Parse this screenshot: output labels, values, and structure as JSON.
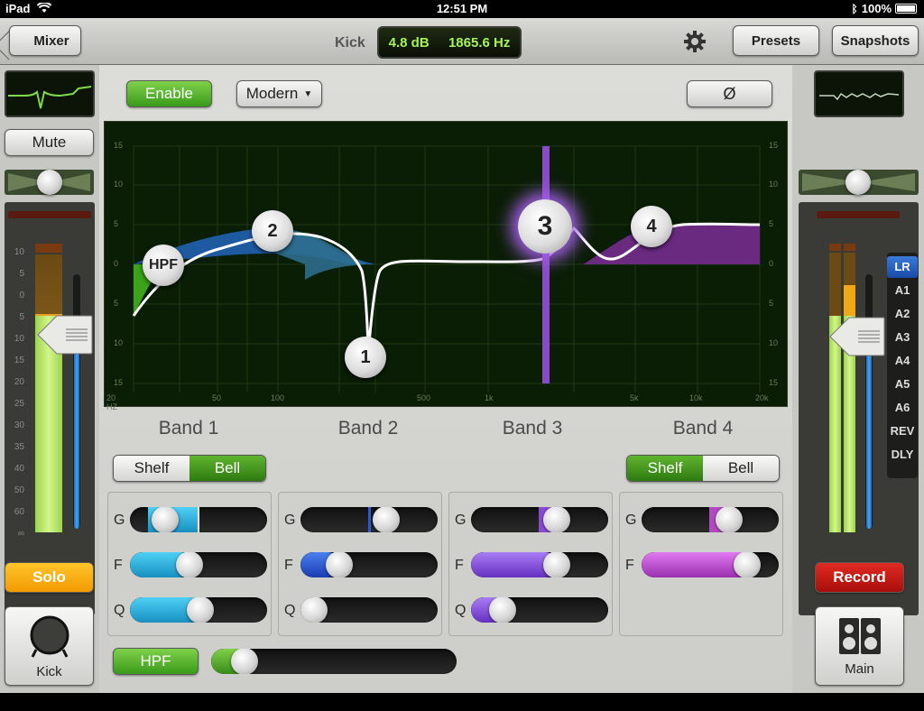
{
  "status": {
    "device": "iPad",
    "time": "12:51 PM",
    "battery": "100%"
  },
  "topbar": {
    "back_label": "Mixer",
    "channel_name": "Kick",
    "readout_gain": "4.8 dB",
    "readout_freq": "1865.6 Hz",
    "presets_label": "Presets",
    "snapshots_label": "Snapshots"
  },
  "left": {
    "mute_label": "Mute",
    "solo_label": "Solo",
    "channel_label": "Kick",
    "scale": [
      "10",
      "5",
      "0",
      "5",
      "10",
      "15",
      "20",
      "25",
      "30",
      "35",
      "40",
      "50",
      "60",
      "∞"
    ]
  },
  "right": {
    "record_label": "Record",
    "main_label": "Main",
    "sends": [
      "LR",
      "A1",
      "A2",
      "A3",
      "A4",
      "A5",
      "A6",
      "REV",
      "DLY"
    ],
    "selected_send": "LR"
  },
  "eq": {
    "enable_label": "Enable",
    "mode_label": "Modern",
    "phase_label": "Ø",
    "hpf_label": "HPF",
    "gain_ticks": [
      "15",
      "10",
      "5",
      "0",
      "5",
      "10",
      "15"
    ],
    "freq_ticks": [
      "20 HZ",
      "50",
      "100",
      "500",
      "1k",
      "5k",
      "10k",
      "20k"
    ],
    "nodes": [
      "HPF",
      "2",
      "1",
      "3",
      "4"
    ],
    "bands": [
      {
        "name": "Band 1",
        "shelf_label": "Shelf",
        "bell_label": "Bell",
        "mode": "Bell",
        "g": 0.2,
        "f": 0.42,
        "q": 0.52
      },
      {
        "name": "Band 2",
        "g": 0.62,
        "f": 0.28,
        "q": 0.1
      },
      {
        "name": "Band 3",
        "g": 0.62,
        "f": 0.62,
        "q": 0.22
      },
      {
        "name": "Band 4",
        "shelf_label": "Shelf",
        "bell_label": "Bell",
        "mode": "Shelf",
        "g": 0.64,
        "f": 0.76
      }
    ],
    "param_labels": {
      "g": "G",
      "f": "F",
      "q": "Q"
    },
    "hpf_value": 0.16
  }
}
